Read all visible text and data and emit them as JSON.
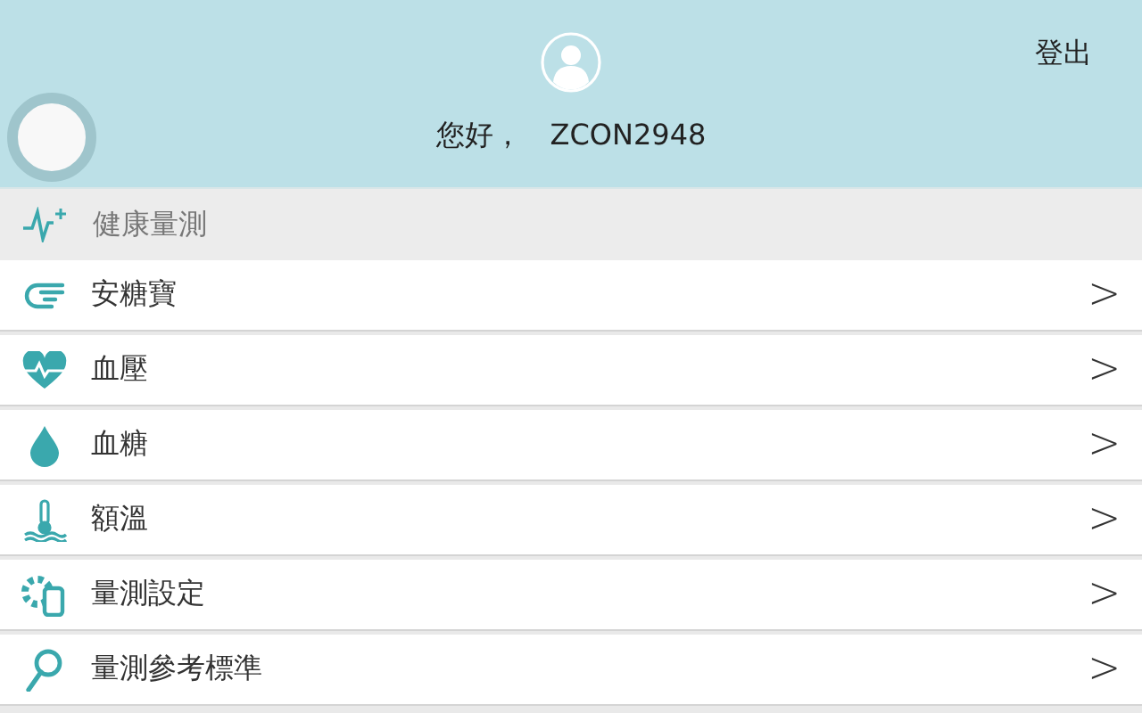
{
  "header": {
    "logout": "登出",
    "greeting": "您好，",
    "username": "ZCON2948"
  },
  "section": {
    "title": "健康量測"
  },
  "items": [
    {
      "label": "安糖寶",
      "chevron": ">"
    },
    {
      "label": "血壓",
      "chevron": ">"
    },
    {
      "label": "血糖",
      "chevron": ">"
    },
    {
      "label": "額溫",
      "chevron": ">"
    },
    {
      "label": "量測設定",
      "chevron": ">"
    },
    {
      "label": "量測參考標準",
      "chevron": ">"
    }
  ]
}
